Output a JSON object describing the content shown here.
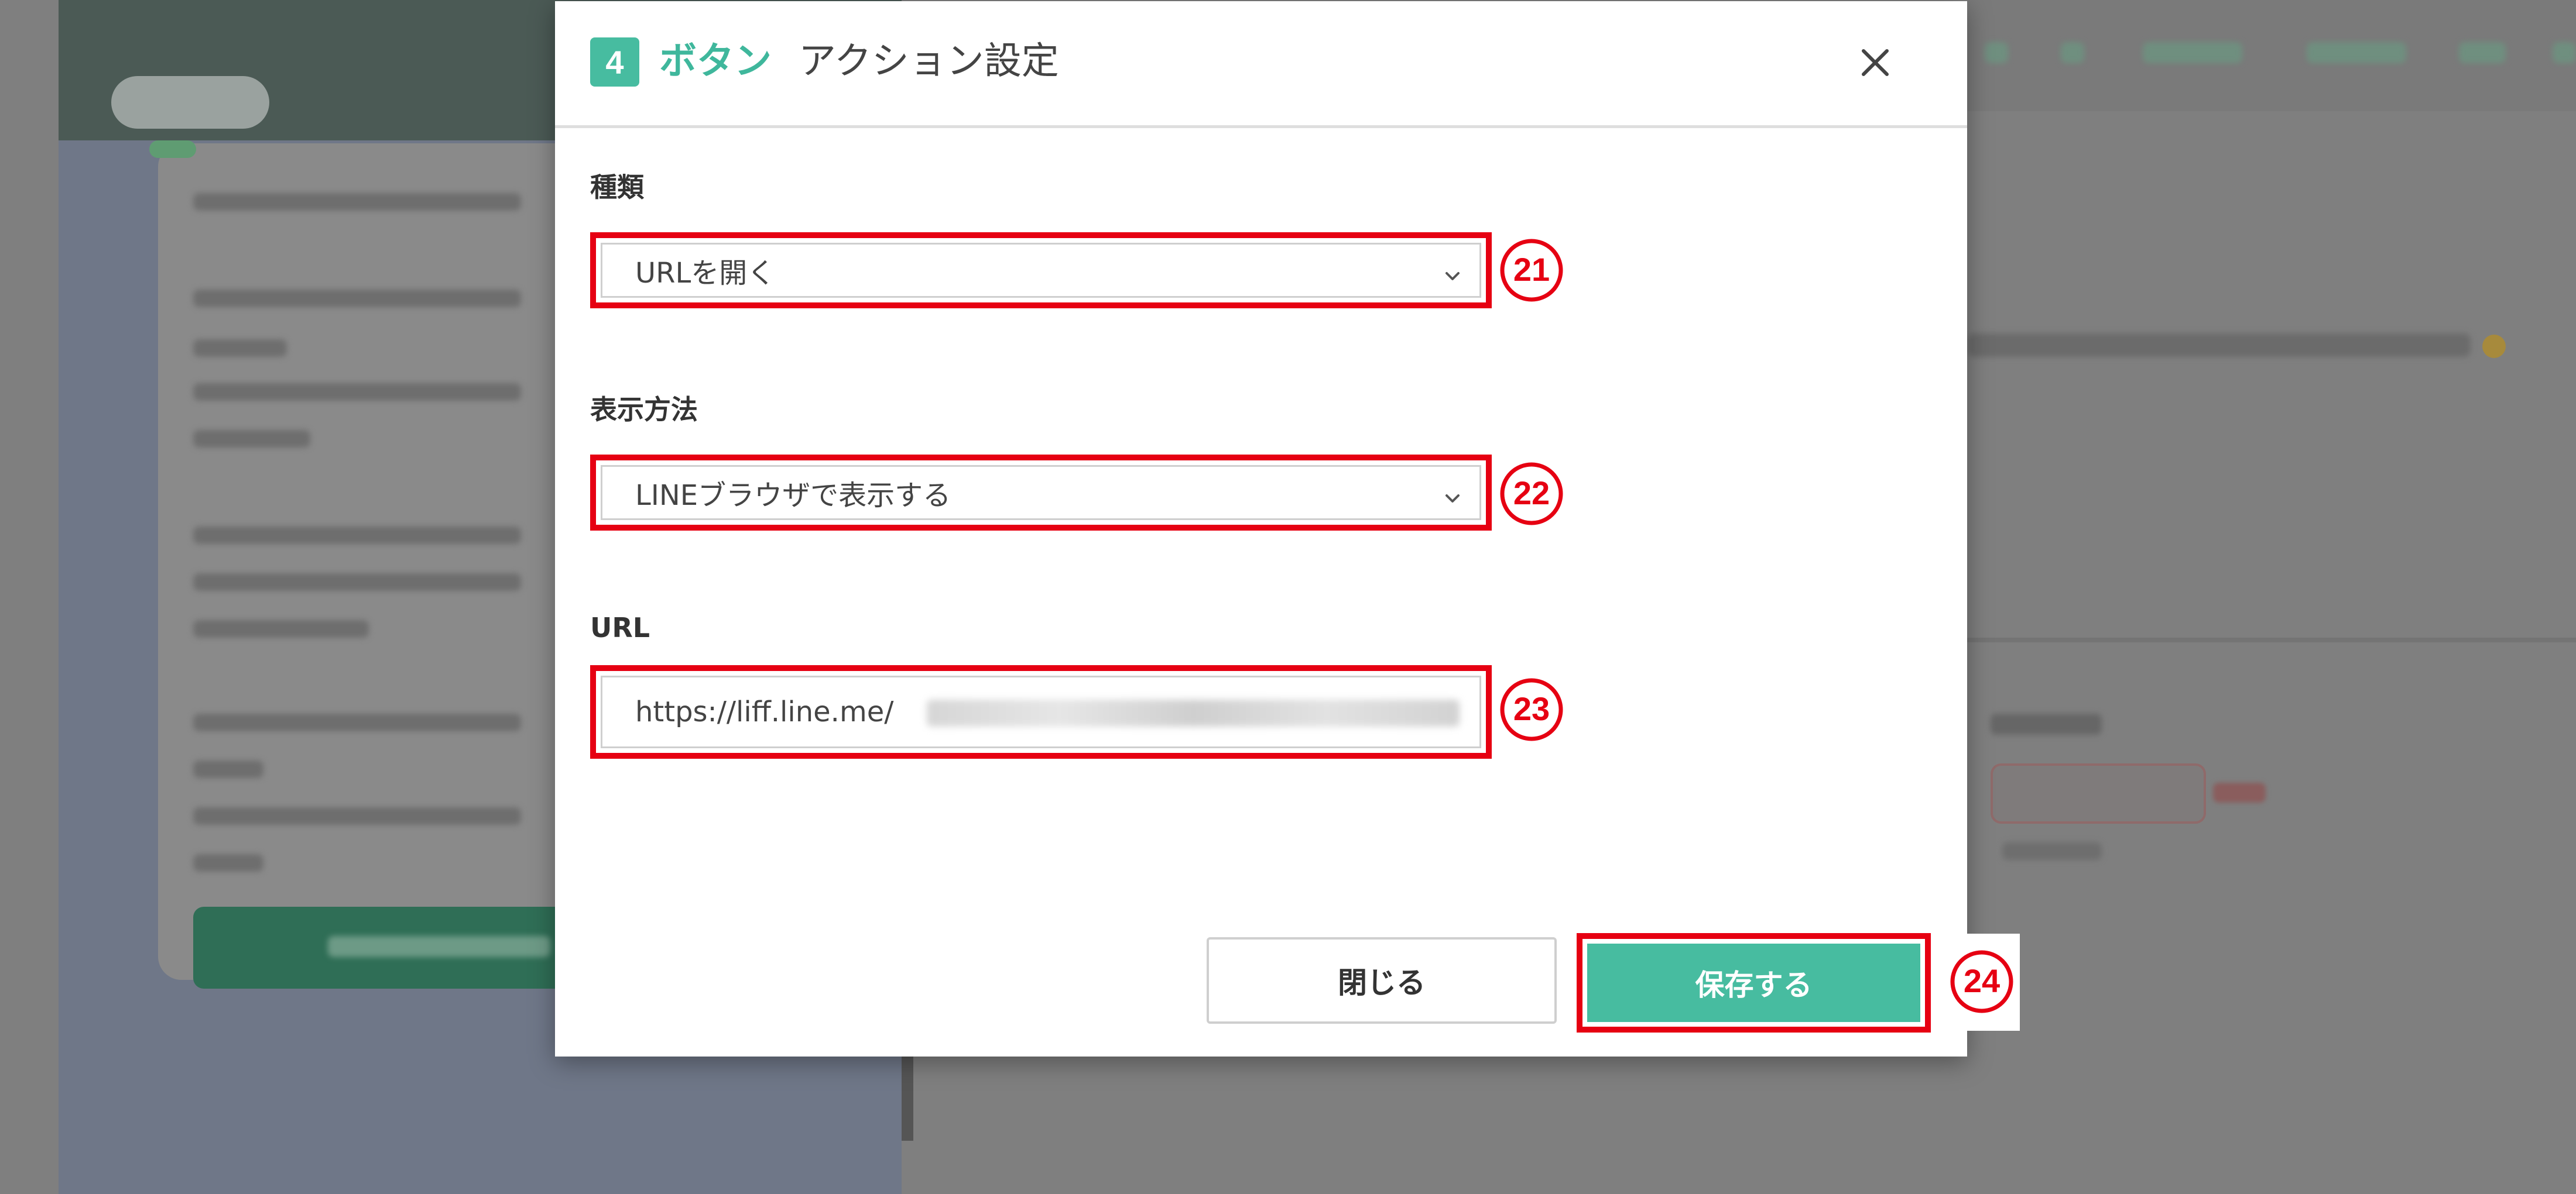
{
  "modal": {
    "step_number": "4",
    "title_emphasis": "ボタン",
    "title_rest": "アクション設定",
    "fields": [
      {
        "label": "種類",
        "value": "URLを開く",
        "callout": "21"
      },
      {
        "label": "表示方法",
        "value": "LINEブラウザで表示する",
        "callout": "22"
      },
      {
        "label": "URL",
        "value": "https://liff.line.me/",
        "callout": "23"
      }
    ],
    "close_button_label": "閉じる",
    "save_button_label": "保存する",
    "save_callout": "24"
  },
  "colors": {
    "accent": "#47bca0",
    "highlight_red": "#e60012",
    "overlay": "#7f7f7f"
  },
  "icons": {
    "close": "close-icon",
    "chevron": "chevron-down-icon"
  }
}
